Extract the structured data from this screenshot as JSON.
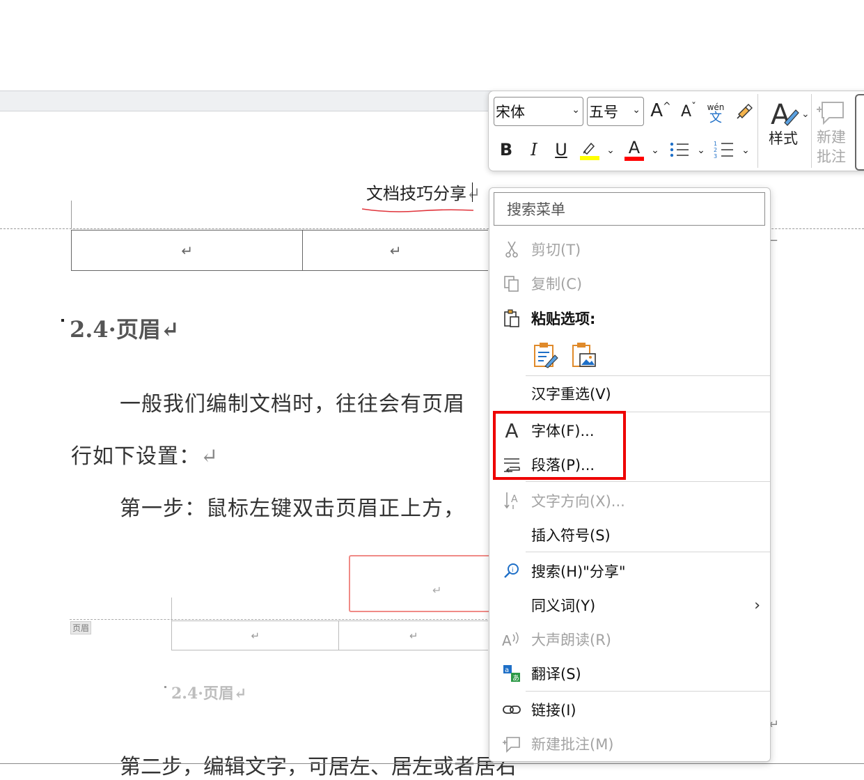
{
  "document": {
    "header_text": "文档技巧分享",
    "return_mark": "↵",
    "heading": "2.4·页眉",
    "para1": "一般我们编制文档时，往往会有页眉",
    "para2": "行如下设置：",
    "para3": "第一步：鼠标左键双击页眉正上方，",
    "header_label": "页眉",
    "thumb_heading": "2.4·页眉",
    "bottom_para": "第二步，编辑文字，可居左、居左或者居右"
  },
  "mini_toolbar": {
    "font_name": "宋体",
    "font_size": "五号",
    "grow_font": "A",
    "shrink_font": "A",
    "phonetic_top": "wén",
    "phonetic_bottom": "文",
    "bold": "B",
    "italic": "I",
    "underline": "U",
    "font_color_letter": "A",
    "styles_label": "样式",
    "new_comment_line1": "新建",
    "new_comment_line2": "批注",
    "highlight_color": "#ffff00",
    "font_color": "#ff0000"
  },
  "context_menu": {
    "search_placeholder": "搜索菜单",
    "cut": "剪切(T)",
    "copy": "复制(C)",
    "paste_options": "粘贴选项:",
    "hanzi_reselect": "汉字重选(V)",
    "font": "字体(F)...",
    "paragraph": "段落(P)...",
    "text_direction": "文字方向(X)...",
    "insert_symbol": "插入符号(S)",
    "search_share": "搜索(H)\"分享\"",
    "synonyms": "同义词(Y)",
    "read_aloud": "大声朗读(R)",
    "translate": "翻译(S)",
    "link": "链接(I)",
    "new_comment": "新建批注(M)"
  },
  "colors": {
    "highlight_box": "#ee0000",
    "accent_blue": "#1e6fc7"
  }
}
